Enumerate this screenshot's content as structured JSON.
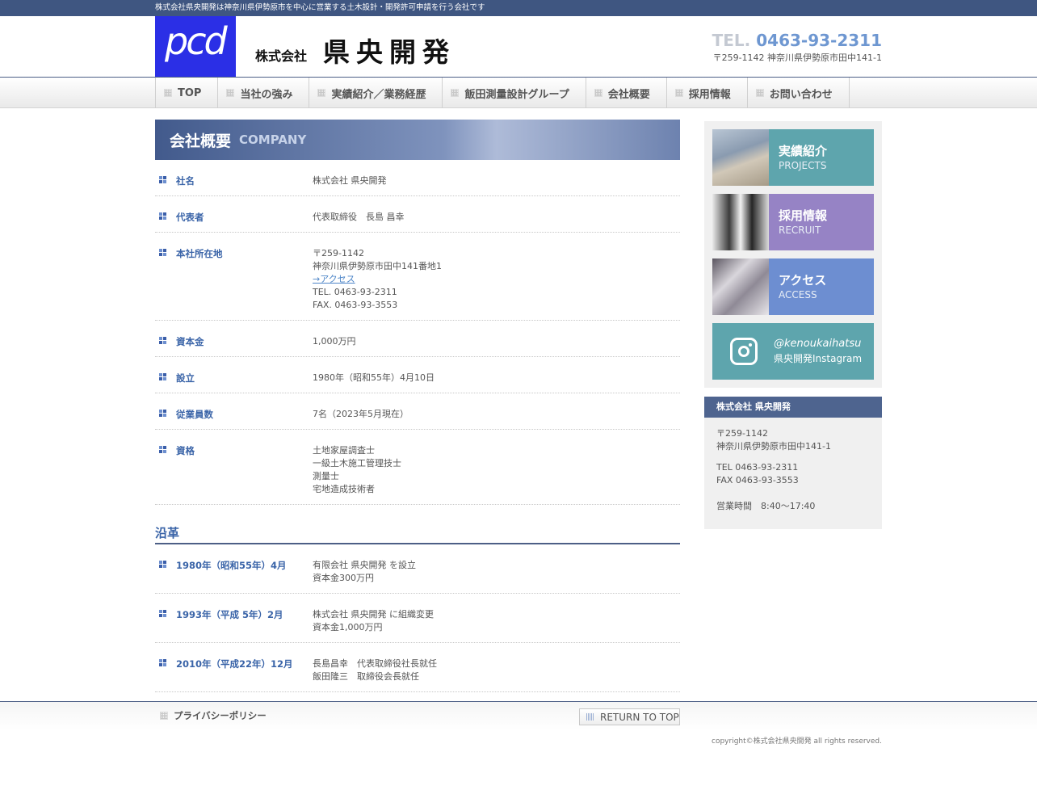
{
  "topbar": {
    "tagline": "株式会社県央開発は神奈川県伊勢原市を中心に営業する土木設計・開発許可申請を行う会社です"
  },
  "header": {
    "logo": "pcd",
    "company_prefix": "株式会社",
    "company_name": "県央開発",
    "tel_prefix": "TEL.",
    "tel_number": "0463-93-2311",
    "address": "〒259-1142 神奈川県伊勢原市田中141-1"
  },
  "nav": {
    "items": [
      {
        "label": "TOP"
      },
      {
        "label": "当社の強み"
      },
      {
        "label": "実績紹介／業務経歴"
      },
      {
        "label": "飯田測量設計グループ"
      },
      {
        "label": "会社概要"
      },
      {
        "label": "採用情報"
      },
      {
        "label": "お問い合わせ"
      }
    ]
  },
  "main": {
    "heading_ja": "会社概要",
    "heading_en": "COMPANY",
    "company_rows": [
      {
        "label": "社名",
        "lines": [
          "株式会社 県央開発"
        ]
      },
      {
        "label": "代表者",
        "lines": [
          "代表取締役　長島 昌幸"
        ]
      },
      {
        "label": "本社所在地",
        "lines": [
          "〒259-1142",
          "神奈川県伊勢原市田中141番地1"
        ],
        "link": "→アクセス",
        "lines_after": [
          "TEL. 0463-93-2311",
          "FAX. 0463-93-3553"
        ]
      },
      {
        "label": "資本金",
        "lines": [
          "1,000万円"
        ]
      },
      {
        "label": "設立",
        "lines": [
          "1980年（昭和55年）4月10日"
        ]
      },
      {
        "label": "従業員数",
        "lines": [
          "7名（2023年5月現在）"
        ]
      },
      {
        "label": "資格",
        "lines": [
          "土地家屋調査士",
          "一級土木施工管理技士",
          "測量士",
          "宅地造成技術者"
        ]
      }
    ],
    "history_heading": "沿革",
    "history_rows": [
      {
        "label": "1980年（昭和55年）4月",
        "lines": [
          "有限会社 県央開発 を設立",
          "資本金300万円"
        ]
      },
      {
        "label": "1993年（平成 5年）2月",
        "lines": [
          "株式会社 県央開発 に組織変更",
          "資本金1,000万円"
        ]
      },
      {
        "label": "2010年（平成22年）12月",
        "lines": [
          "長島昌幸　代表取締役社長就任",
          "飯田隆三　取締役会長就任"
        ]
      }
    ],
    "return_top": "RETURN TO TOP"
  },
  "sidebar": {
    "banners": [
      {
        "ja": "実績紹介",
        "en": "PROJECTS"
      },
      {
        "ja": "採用情報",
        "en": "RECRUIT"
      },
      {
        "ja": "アクセス",
        "en": "ACCESS"
      }
    ],
    "instagram": {
      "handle": "@kenoukaihatsu",
      "label": "県央開発Instagram"
    },
    "info": {
      "title": "株式会社 県央開発",
      "postal": "〒259-1142",
      "address": "神奈川県伊勢原市田中141-1",
      "tel": "TEL 0463-93-2311",
      "fax": "FAX 0463-93-3553",
      "hours": "営業時間　8:40〜17:40"
    }
  },
  "footer": {
    "privacy": "プライバシーポリシー",
    "copyright": "copyright©株式会社県央開発  all rights reserved."
  },
  "colors": {
    "nav_border": "#4d5f86",
    "accent_blue": "#3a64a8",
    "tel_blue": "#6e97d1",
    "logo_blue": "#2b2fe6"
  }
}
